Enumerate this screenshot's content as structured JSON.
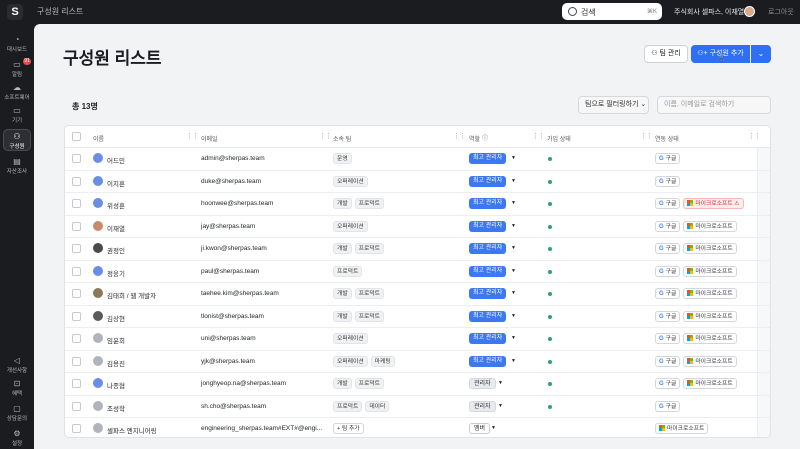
{
  "topbar": {
    "logo": "S",
    "title": "구성원 리스트",
    "search_label": "검색",
    "search_shortcut": "⌘K",
    "company": "주식회사 셀파스, 이재열님",
    "logout": "로그아웃"
  },
  "sidebar": {
    "items": [
      {
        "label": "대시보드",
        "icon": "dashboard-icon",
        "glyph": "◔"
      },
      {
        "label": "알림",
        "icon": "bell-icon",
        "glyph": "▭",
        "badge": "91"
      },
      {
        "label": "소프트웨어",
        "icon": "cloud-icon",
        "glyph": "☁"
      },
      {
        "label": "기기",
        "icon": "monitor-icon",
        "glyph": "▭"
      },
      {
        "label": "구성원",
        "icon": "users-icon",
        "glyph": "⚇",
        "active": true
      },
      {
        "label": "자산조사",
        "icon": "clipboard-icon",
        "glyph": "▤"
      },
      {
        "label": "개선사항",
        "icon": "megaphone-icon",
        "glyph": "◁"
      },
      {
        "label": "혜택",
        "icon": "cart-icon",
        "glyph": "⊡"
      },
      {
        "label": "상담문의",
        "icon": "chat-icon",
        "glyph": "▢"
      },
      {
        "label": "설정",
        "icon": "gear-icon",
        "glyph": "⚙"
      }
    ]
  },
  "header": {
    "title": "구성원 리스트",
    "team_manage": "팀 관리",
    "add_member": "구성원 추가",
    "dropdown_caret": "⌄"
  },
  "toolbar": {
    "total": "총 13명",
    "filter": "팀으로 필터링하기",
    "search_placeholder": "이름, 이메일로 검색하기"
  },
  "table": {
    "columns": [
      "이름",
      "이메일",
      "소속 팀",
      "역할",
      "가입 상태",
      "연동 상태"
    ],
    "add_team_label": "+ 팀 추가",
    "rows": [
      {
        "name": "어드민",
        "email": "admin@sherpas.team",
        "teams": [
          "운영"
        ],
        "role": "최고 관리자",
        "role_type": "admin",
        "joined": true,
        "links": [
          {
            "label": "구글",
            "type": "google"
          }
        ],
        "avatar": "#6b8de3"
      },
      {
        "name": "이지훈",
        "email": "duke@sherpas.team",
        "teams": [
          "오퍼레이션"
        ],
        "role": "최고 관리자",
        "role_type": "admin",
        "joined": true,
        "links": [
          {
            "label": "구글",
            "type": "google"
          }
        ],
        "avatar": "#6b8de3"
      },
      {
        "name": "위성훈",
        "email": "hoonwee@sherpas.team",
        "teams": [
          "개발",
          "프로덕트"
        ],
        "role": "최고 관리자",
        "role_type": "admin",
        "joined": true,
        "links": [
          {
            "label": "구글",
            "type": "google"
          },
          {
            "label": "마이크로소프트",
            "type": "ms",
            "warn": true
          }
        ],
        "avatar": "#6b8de3"
      },
      {
        "name": "이재열",
        "email": "jay@sherpas.team",
        "teams": [
          "오퍼레이션"
        ],
        "role": "최고 관리자",
        "role_type": "admin",
        "joined": true,
        "links": [
          {
            "label": "구글",
            "type": "google"
          },
          {
            "label": "마이크로소프트",
            "type": "ms"
          }
        ],
        "avatar": "#c98a6b"
      },
      {
        "name": "권정인",
        "email": "ji.kwon@sherpas.team",
        "teams": [
          "개발",
          "프로덕트"
        ],
        "role": "최고 관리자",
        "role_type": "admin",
        "joined": true,
        "links": [
          {
            "label": "구글",
            "type": "google"
          },
          {
            "label": "마이크로소프트",
            "type": "ms"
          }
        ],
        "avatar": "#4a4a4a"
      },
      {
        "name": "정웅기",
        "email": "paul@sherpas.team",
        "teams": [
          "프로덕트"
        ],
        "role": "최고 관리자",
        "role_type": "admin",
        "joined": true,
        "links": [
          {
            "label": "구글",
            "type": "google"
          },
          {
            "label": "마이크로소프트",
            "type": "ms"
          }
        ],
        "avatar": "#6b8de3"
      },
      {
        "name": "김태희 / 웹 개발자",
        "email": "taehee.kim@sherpas.team",
        "teams": [
          "개발",
          "프로덕트"
        ],
        "role": "최고 관리자",
        "role_type": "admin",
        "joined": true,
        "links": [
          {
            "label": "구글",
            "type": "google"
          },
          {
            "label": "마이크로소프트",
            "type": "ms"
          }
        ],
        "avatar": "#8a7a5a"
      },
      {
        "name": "김상현",
        "email": "tlonist@sherpas.team",
        "teams": [
          "개발",
          "프로덕트"
        ],
        "role": "최고 관리자",
        "role_type": "admin",
        "joined": true,
        "links": [
          {
            "label": "구글",
            "type": "google"
          },
          {
            "label": "마이크로소프트",
            "type": "ms"
          }
        ],
        "avatar": "#5a5a5a"
      },
      {
        "name": "임윤희",
        "email": "uni@sherpas.team",
        "teams": [
          "오퍼레이션"
        ],
        "role": "최고 관리자",
        "role_type": "admin",
        "joined": true,
        "links": [
          {
            "label": "구글",
            "type": "google"
          },
          {
            "label": "마이크로소프트",
            "type": "ms"
          }
        ],
        "avatar": "#b0b4bb"
      },
      {
        "name": "김용진",
        "email": "yjk@sherpas.team",
        "teams": [
          "오퍼레이션",
          "마케팅"
        ],
        "role": "최고 관리자",
        "role_type": "admin",
        "joined": true,
        "links": [
          {
            "label": "구글",
            "type": "google"
          },
          {
            "label": "마이크로소프트",
            "type": "ms"
          }
        ],
        "avatar": "#b0b4bb"
      },
      {
        "name": "나종협",
        "email": "jonghyeop.na@sherpas.team",
        "teams": [
          "개발",
          "프로덕트"
        ],
        "role": "관리자",
        "role_type": "mgr",
        "joined": true,
        "links": [
          {
            "label": "구글",
            "type": "google"
          },
          {
            "label": "마이크로소프트",
            "type": "ms"
          }
        ],
        "avatar": "#6b8de3"
      },
      {
        "name": "조성학",
        "email": "sh.cho@sherpas.team",
        "teams": [
          "프로덕트",
          "데이터"
        ],
        "role": "관리자",
        "role_type": "mgr",
        "joined": true,
        "links": [
          {
            "label": "구글",
            "type": "google"
          }
        ],
        "avatar": "#b0b4bb"
      },
      {
        "name": "셀파스 엔지니어링",
        "email": "engineering_sherpas.team#EXT#@engi...",
        "teams": [],
        "role": "멤버",
        "role_type": "member",
        "joined": false,
        "links": [
          {
            "label": "마이크로소프트",
            "type": "ms"
          }
        ],
        "avatar": "#b0b4bb"
      }
    ]
  }
}
